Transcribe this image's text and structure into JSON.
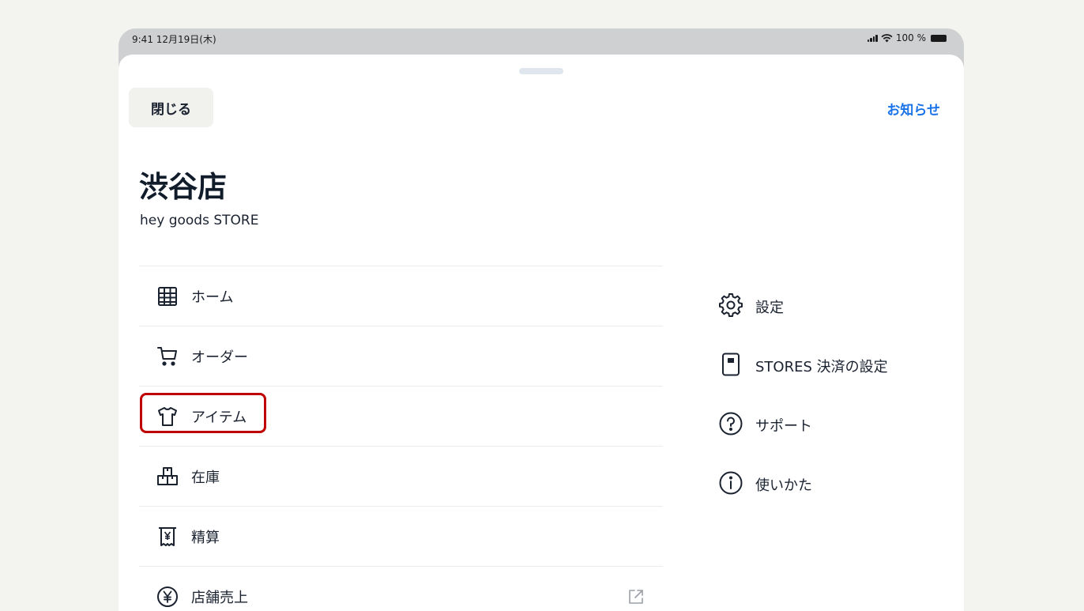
{
  "status_bar": {
    "time_date": "9:41  12月19日(木)",
    "battery": "100 %"
  },
  "header": {
    "close_label": "閉じる",
    "notice_label": "お知らせ"
  },
  "store": {
    "name": "渋谷店",
    "subtitle": "hey goods STORE"
  },
  "menu_left": [
    {
      "label": "ホーム",
      "icon": "grid-icon"
    },
    {
      "label": "オーダー",
      "icon": "cart-icon"
    },
    {
      "label": "アイテム",
      "icon": "tshirt-icon"
    },
    {
      "label": "在庫",
      "icon": "boxes-icon"
    },
    {
      "label": "精算",
      "icon": "receipt-yen-icon"
    },
    {
      "label": "店舗売上",
      "icon": "yen-circle-icon",
      "external": true
    }
  ],
  "menu_right": [
    {
      "label": "設定",
      "icon": "gear-icon"
    },
    {
      "label": "STORES 決済の設定",
      "icon": "card-reader-icon"
    },
    {
      "label": "サポート",
      "icon": "question-circle-icon"
    },
    {
      "label": "使いかた",
      "icon": "info-circle-icon"
    }
  ],
  "colors": {
    "accent": "#1a73e8",
    "highlight": "#c00000",
    "text": "#1a2230"
  }
}
